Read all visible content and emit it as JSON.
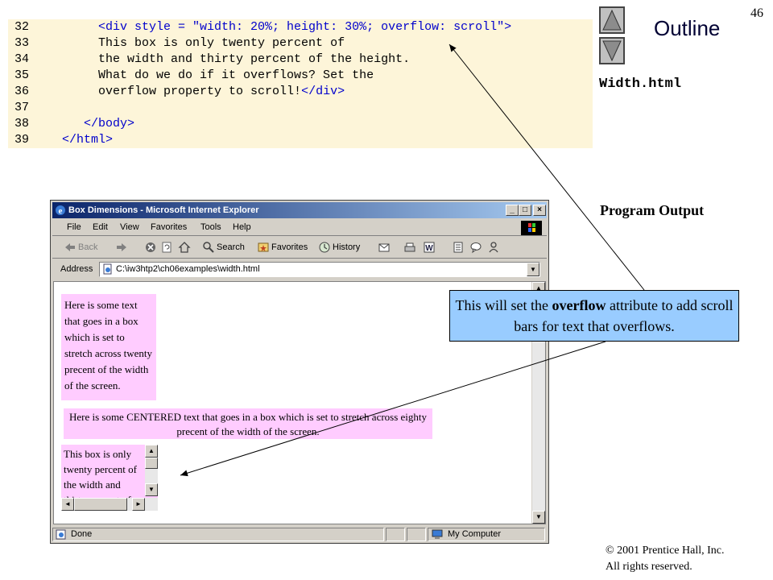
{
  "slide_number": "46",
  "code": {
    "lines": [
      {
        "num": "32",
        "indent": "        ",
        "parts": [
          {
            "t": "<div style = \"width: 20%; height: 30%; overflow: scroll\">",
            "c": "tag"
          }
        ]
      },
      {
        "num": "33",
        "indent": "        ",
        "parts": [
          {
            "t": "This box is only twenty percent of",
            "c": "txt"
          }
        ]
      },
      {
        "num": "34",
        "indent": "        ",
        "parts": [
          {
            "t": "the width and thirty percent of the height.",
            "c": "txt"
          }
        ]
      },
      {
        "num": "35",
        "indent": "        ",
        "parts": [
          {
            "t": "What do we do if it overflows? Set the",
            "c": "txt"
          }
        ]
      },
      {
        "num": "36",
        "indent": "        ",
        "parts": [
          {
            "t": "overflow property to scroll!",
            "c": "txt"
          },
          {
            "t": "</div>",
            "c": "tag"
          }
        ]
      },
      {
        "num": "37",
        "indent": "",
        "parts": []
      },
      {
        "num": "38",
        "indent": "      ",
        "parts": [
          {
            "t": "</body>",
            "c": "tag"
          }
        ]
      },
      {
        "num": "39",
        "indent": "   ",
        "parts": [
          {
            "t": "</html>",
            "c": "tag"
          }
        ]
      }
    ]
  },
  "sidebar": {
    "outline_title": "Outline",
    "file_name": "Width.html",
    "program_output": "Program Output",
    "copyright_line1": "© 2001 Prentice Hall, Inc.",
    "copyright_line2": "All rights reserved."
  },
  "callout": {
    "pre": "This will set the ",
    "bold": "overflow",
    "post": " attribute to add scroll bars for text that overflows."
  },
  "browser": {
    "title": "Box Dimensions - Microsoft Internet Explorer",
    "menu": [
      "File",
      "Edit",
      "View",
      "Favorites",
      "Tools",
      "Help"
    ],
    "toolbar": {
      "back": "Back",
      "search": "Search",
      "favorites": "Favorites",
      "history": "History"
    },
    "address_label": "Address",
    "address_value": "C:\\iw3htp2\\ch06examples\\width.html",
    "box1_text": "Here is some text that goes in a box which is set to stretch across twenty precent of the width of the screen.",
    "box2_text": "Here is some CENTERED text that goes in a box which is set to stretch across eighty precent of the width of the screen.",
    "box3_text": "This box is only twenty percent of the width and thirty percent of the height.",
    "status_left": "Done",
    "status_zone": "My Computer"
  },
  "colors": {
    "code_bg": "#fdf5d9",
    "code_tag": "#0000cc",
    "box_bg": "#ffccff",
    "callout_bg": "#99ccff",
    "titlebar_start": "#0a246a"
  }
}
